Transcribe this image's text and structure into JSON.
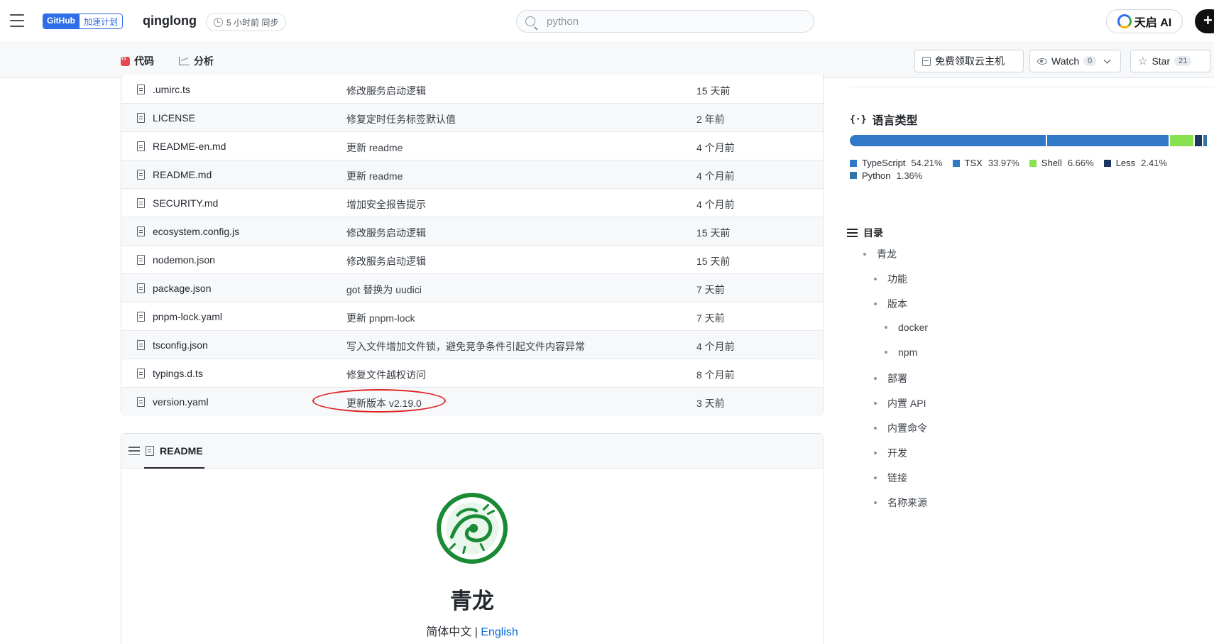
{
  "header": {
    "badge_github": "GitHub",
    "badge_speed": "加速计划",
    "repo_name": "qinglong",
    "sync_text": "5 小时前 同步",
    "search_placeholder": "python",
    "ai_button_label": "天启 AI",
    "plus_label": "+"
  },
  "subnav": {
    "tabs": [
      {
        "label": "代码",
        "icon": "code-icon"
      },
      {
        "label": "分析",
        "icon": "chart-icon"
      }
    ],
    "cloud_button": "免费领取云主机",
    "watch": {
      "label": "Watch",
      "count": "0"
    },
    "star": {
      "label": "Star",
      "count": "21"
    }
  },
  "files": [
    {
      "name": ".umirc.ts",
      "message": "修改服务启动逻辑",
      "date": "15 天前"
    },
    {
      "name": "LICENSE",
      "message": "修复定时任务标签默认值",
      "date": "2 年前"
    },
    {
      "name": "README-en.md",
      "message": "更新 readme",
      "date": "4 个月前"
    },
    {
      "name": "README.md",
      "message": "更新 readme",
      "date": "4 个月前"
    },
    {
      "name": "SECURITY.md",
      "message": "增加安全报告提示",
      "date": "4 个月前"
    },
    {
      "name": "ecosystem.config.js",
      "message": "修改服务启动逻辑",
      "date": "15 天前"
    },
    {
      "name": "nodemon.json",
      "message": "修改服务启动逻辑",
      "date": "15 天前"
    },
    {
      "name": "package.json",
      "message": "got 替换为 uudici",
      "date": "7 天前"
    },
    {
      "name": "pnpm-lock.yaml",
      "message": "更新 pnpm-lock",
      "date": "7 天前"
    },
    {
      "name": "tsconfig.json",
      "message": "写入文件增加文件锁，避免竞争条件引起文件内容异常",
      "date": "4 个月前"
    },
    {
      "name": "typings.d.ts",
      "message": "修复文件越权访问",
      "date": "8 个月前"
    },
    {
      "name": "version.yaml",
      "message": "更新版本 v2.19.0",
      "date": "3 天前"
    }
  ],
  "readme": {
    "tab_label": "README",
    "title": "青龙",
    "lang_current": "简体中文",
    "lang_separator": " | ",
    "lang_link": "English"
  },
  "languages": {
    "title": "语言类型",
    "items": [
      {
        "name": "TypeScript",
        "percent": "54.21%",
        "value": 54.21,
        "color": "#3178c6"
      },
      {
        "name": "TSX",
        "percent": "33.97%",
        "value": 33.97,
        "color": "#3178c6"
      },
      {
        "name": "Shell",
        "percent": "6.66%",
        "value": 6.66,
        "color": "#89e051"
      },
      {
        "name": "Less",
        "percent": "2.41%",
        "value": 2.41,
        "color": "#1d365d"
      },
      {
        "name": "Python",
        "percent": "1.36%",
        "value": 1.36,
        "color": "#3572a5"
      }
    ]
  },
  "toc": {
    "title": "目录",
    "items": [
      {
        "label": "青龙",
        "level": 1
      },
      {
        "label": "功能",
        "level": 2
      },
      {
        "label": "版本",
        "level": 2
      },
      {
        "label": "docker",
        "level": 3
      },
      {
        "label": "npm",
        "level": 3
      },
      {
        "label": "部署",
        "level": 2
      },
      {
        "label": "内置 API",
        "level": 2
      },
      {
        "label": "内置命令",
        "level": 2
      },
      {
        "label": "开发",
        "level": 2
      },
      {
        "label": "链接",
        "level": 2
      },
      {
        "label": "名称来源",
        "level": 2
      }
    ]
  }
}
